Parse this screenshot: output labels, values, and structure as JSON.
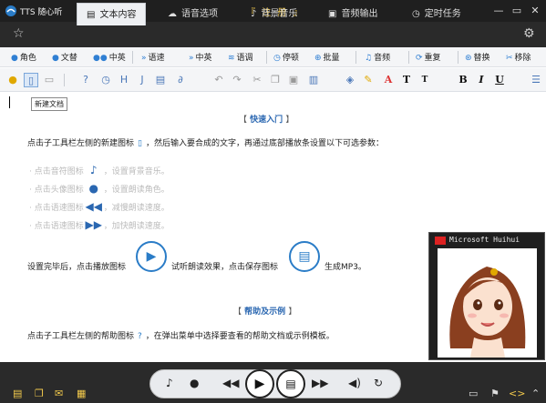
{
  "titlebar": {
    "title": "TTS 随心听",
    "register": "『 注 册 』",
    "minimize": "—",
    "restore": "▭",
    "close": "✕"
  },
  "tabs": [
    {
      "label": "文本内容",
      "icon": "document-icon",
      "glyph": "▤",
      "active": true
    },
    {
      "label": "语音选项",
      "icon": "chat-bubble-icon",
      "glyph": "☁",
      "active": false
    },
    {
      "label": "背景音乐",
      "icon": "music-note-icon",
      "glyph": "♪",
      "active": false
    },
    {
      "label": "音频输出",
      "icon": "audio-output-icon",
      "glyph": "▣",
      "active": false
    },
    {
      "label": "定时任务",
      "icon": "clock-icon",
      "glyph": "◷",
      "active": false
    }
  ],
  "toolbar1": [
    {
      "label": "角色",
      "icon": "person-icon",
      "glyph": "👤"
    },
    {
      "label": "文替",
      "icon": "person-swap-icon",
      "glyph": "👤"
    },
    {
      "label": "中英",
      "icon": "people-icon",
      "glyph": "👥"
    },
    {
      "label": "语速",
      "icon": "speed-icon",
      "glyph": "»"
    },
    {
      "label": "中英",
      "icon": "speed-icon",
      "glyph": "»"
    },
    {
      "label": "语调",
      "icon": "tone-icon",
      "glyph": "≋"
    },
    {
      "label": "停顿",
      "icon": "pause-icon",
      "glyph": "◷"
    },
    {
      "label": "批量",
      "icon": "batch-icon",
      "glyph": "⊕"
    },
    {
      "label": "音频",
      "icon": "audio-icon",
      "glyph": "♫"
    },
    {
      "label": "重复",
      "icon": "repeat-icon",
      "glyph": "⟳"
    },
    {
      "label": "替换",
      "icon": "replace-icon",
      "glyph": "⊛"
    },
    {
      "label": "移除",
      "icon": "remove-icon",
      "glyph": "✂"
    }
  ],
  "toolbar2": {
    "new_tooltip": "新建文档",
    "bold": "B",
    "italic": "I",
    "underline": "U",
    "text_a": "A",
    "text_t": "T",
    "text_t2": "T"
  },
  "doc": {
    "quick_title": "快速入门",
    "bracket_open": "【",
    "bracket_close": "】",
    "line1_a": "点击子工具栏左侧的新建图标",
    "line1_b": "，然后输入要合成的文字，再通过底部播放条设置以下可选参数：",
    "opt1_a": "· 点击音符图标",
    "opt1_b": "，设置背景音乐。",
    "opt2_a": "· 点击头像图标",
    "opt2_b": "，设置朗读角色。",
    "opt3_a": "· 点击语速图标",
    "opt3_b": "，减慢朗读速度。",
    "opt4_a": "· 点击语速图标",
    "opt4_b": "，加快朗读速度。",
    "play_a": "设置完毕后，点击播放图标",
    "play_b": "试听朗读效果，点击保存图标",
    "play_c": "生成MP3。",
    "help_title": "帮助及示例",
    "help_a": "点击子工具栏左侧的帮助图标",
    "help_b": "，在弹出菜单中选择要查看的帮助文档或示例模板。"
  },
  "avatar_panel": {
    "title": "Microsoft Huihui"
  },
  "colors": {
    "accent": "#2a7cc7",
    "register": "#f2c94c",
    "dark_bar": "#2a2a2a"
  }
}
